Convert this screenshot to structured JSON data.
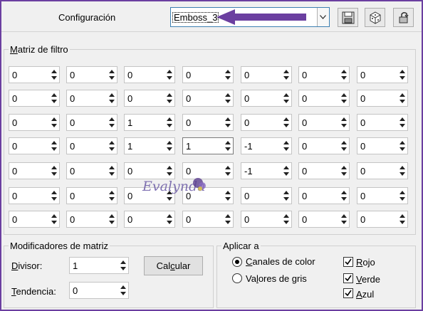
{
  "header": {
    "preset_label": "Configuración",
    "preset_value": "Emboss_3",
    "icons": [
      "save-icon",
      "randomize-dice-icon",
      "reset-icon"
    ]
  },
  "matrix": {
    "title": "Matriz de filtro",
    "title_mnemonic": "M",
    "title_rest": "atriz de filtro",
    "rows": [
      [
        "0",
        "0",
        "0",
        "0",
        "0",
        "0",
        "0"
      ],
      [
        "0",
        "0",
        "0",
        "0",
        "0",
        "0",
        "0"
      ],
      [
        "0",
        "0",
        "1",
        "0",
        "0",
        "0",
        "0"
      ],
      [
        "0",
        "0",
        "1",
        "1",
        "-1",
        "0",
        "0"
      ],
      [
        "0",
        "0",
        "0",
        "0",
        "-1",
        "0",
        "0"
      ],
      [
        "0",
        "0",
        "0",
        "0",
        "0",
        "0",
        "0"
      ],
      [
        "0",
        "0",
        "0",
        "0",
        "0",
        "0",
        "0"
      ]
    ]
  },
  "modifiers": {
    "title": "Modificadores de matriz",
    "divisor_label": "Divisor:",
    "divisor_mn": "D",
    "divisor_rest": "ivisor:",
    "divisor_value": "1",
    "bias_label": "Tendencia:",
    "bias_mn": "T",
    "bias_rest": "endencia:",
    "bias_value": "0",
    "calc_button": "Calcular",
    "calc_pre": "Cal",
    "calc_mn": "c",
    "calc_rest": "ular"
  },
  "apply": {
    "title": "Aplicar a",
    "color_channels_pre": "",
    "color_channels_mn": "C",
    "color_channels_rest": "anales de color",
    "color_channels_selected": true,
    "gray_pre": "Va",
    "gray_mn": "l",
    "gray_rest": "ores de gris",
    "red_mn": "R",
    "red_rest": "ojo",
    "green_mn": "V",
    "green_rest": "erde",
    "blue_mn": "A",
    "blue_rest": "zul",
    "red_checked": true,
    "green_checked": true,
    "blue_checked": true
  },
  "watermark": "Evalynda",
  "colors": {
    "accent": "#6b3fa0",
    "focus_border": "#3c7fb1"
  }
}
